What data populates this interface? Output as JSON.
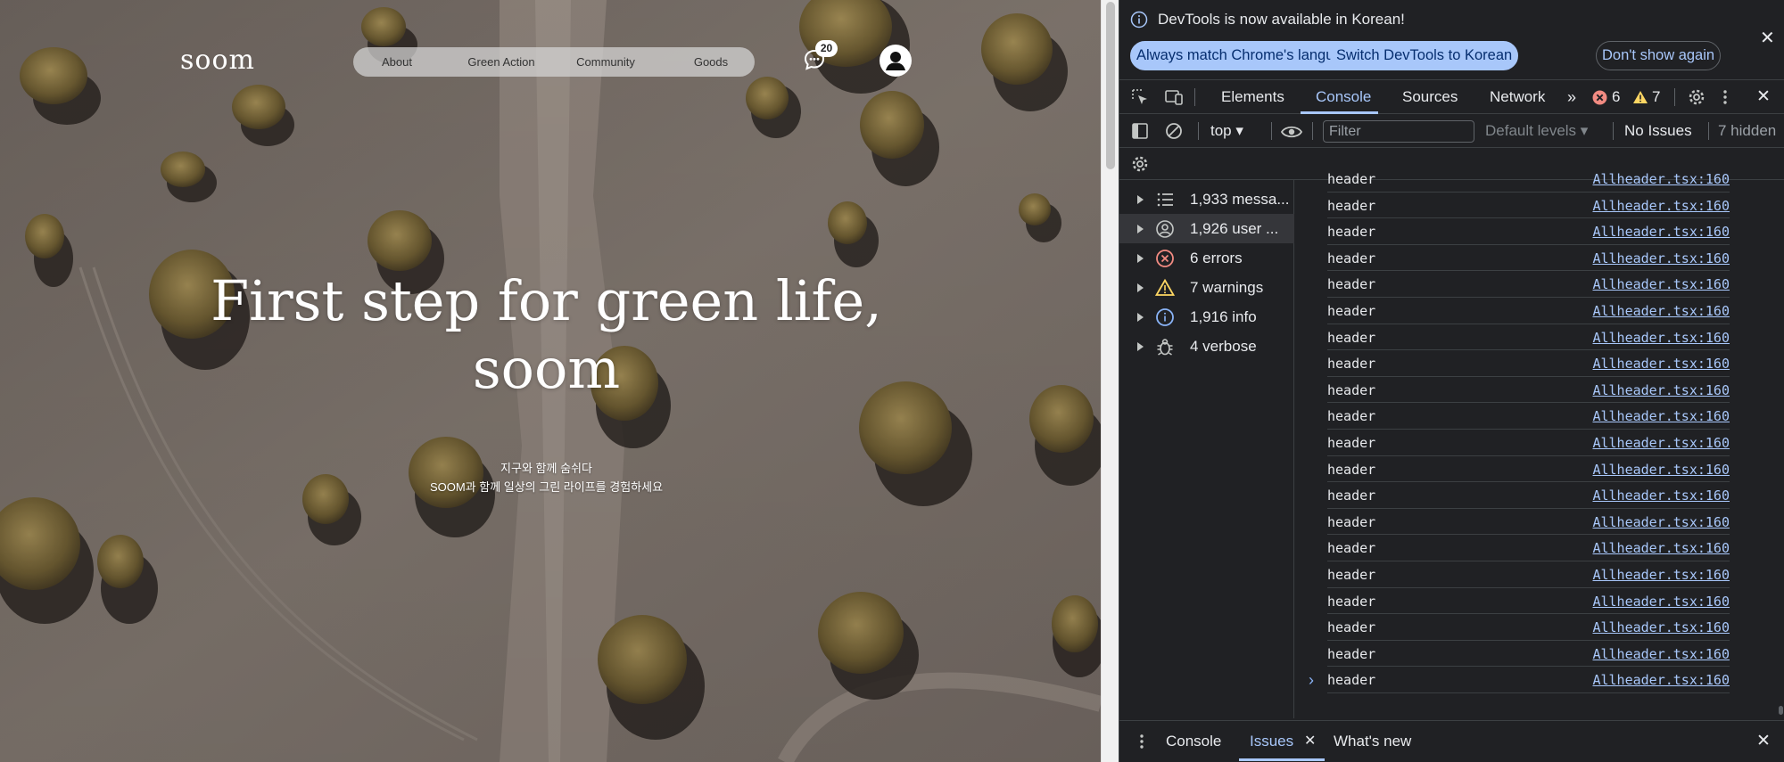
{
  "site": {
    "logo": "soom",
    "nav": [
      {
        "label": "About"
      },
      {
        "label": "Green Action"
      },
      {
        "label": "Community"
      },
      {
        "label": "Goods"
      }
    ],
    "chat_badge": "20",
    "hero_title_line1": "First step for green life,",
    "hero_title_line2": "soom",
    "hero_sub_line1": "지구와 함께 숨쉬다",
    "hero_sub_line2": "SOOM과 함께 일상의 그린 라이프를 경험하세요"
  },
  "devtools": {
    "infobar": {
      "message": "DevTools is now available in Korean!",
      "btn_match": "Always match Chrome's language",
      "btn_switch": "Switch DevTools to Korean",
      "btn_dismiss": "Don't show again"
    },
    "tabs": [
      "Elements",
      "Console",
      "Sources",
      "Network"
    ],
    "active_tab": "Console",
    "error_count": "6",
    "warning_count": "7",
    "toolbar": {
      "context": "top",
      "filter_placeholder": "Filter",
      "levels": "Default levels",
      "issues": "No Issues",
      "hidden": "7 hidden"
    },
    "sidebar": [
      {
        "label": "1,933 messa...",
        "icon": "list-icon"
      },
      {
        "label": "1,926 user ...",
        "icon": "user-icon"
      },
      {
        "label": "6 errors",
        "icon": "error-icon"
      },
      {
        "label": "7 warnings",
        "icon": "warning-icon"
      },
      {
        "label": "1,916 info",
        "icon": "info-icon"
      },
      {
        "label": "4 verbose",
        "icon": "bug-icon"
      }
    ],
    "log_partial": {
      "message": "header",
      "source": "Allheader.tsx:160"
    },
    "log_rows": [
      {
        "message": "header",
        "source": "Allheader.tsx:160"
      },
      {
        "message": "header",
        "source": "Allheader.tsx:160"
      },
      {
        "message": "header",
        "source": "Allheader.tsx:160"
      },
      {
        "message": "header",
        "source": "Allheader.tsx:160"
      },
      {
        "message": "header",
        "source": "Allheader.tsx:160"
      },
      {
        "message": "header",
        "source": "Allheader.tsx:160"
      },
      {
        "message": "header",
        "source": "Allheader.tsx:160"
      },
      {
        "message": "header",
        "source": "Allheader.tsx:160"
      },
      {
        "message": "header",
        "source": "Allheader.tsx:160"
      },
      {
        "message": "header",
        "source": "Allheader.tsx:160"
      },
      {
        "message": "header",
        "source": "Allheader.tsx:160"
      },
      {
        "message": "header",
        "source": "Allheader.tsx:160"
      },
      {
        "message": "header",
        "source": "Allheader.tsx:160"
      },
      {
        "message": "header",
        "source": "Allheader.tsx:160"
      },
      {
        "message": "header",
        "source": "Allheader.tsx:160"
      },
      {
        "message": "header",
        "source": "Allheader.tsx:160"
      },
      {
        "message": "header",
        "source": "Allheader.tsx:160"
      },
      {
        "message": "header",
        "source": "Allheader.tsx:160"
      },
      {
        "message": "header",
        "source": "Allheader.tsx:160"
      }
    ],
    "prompt": "›",
    "drawer_tabs": [
      "Console",
      "Issues",
      "What's new"
    ],
    "drawer_active": "Issues"
  },
  "colors": {
    "devtools_bg": "#202124",
    "accent": "#a8c7fa",
    "error": "#f28b82",
    "warning": "#fdd663"
  }
}
